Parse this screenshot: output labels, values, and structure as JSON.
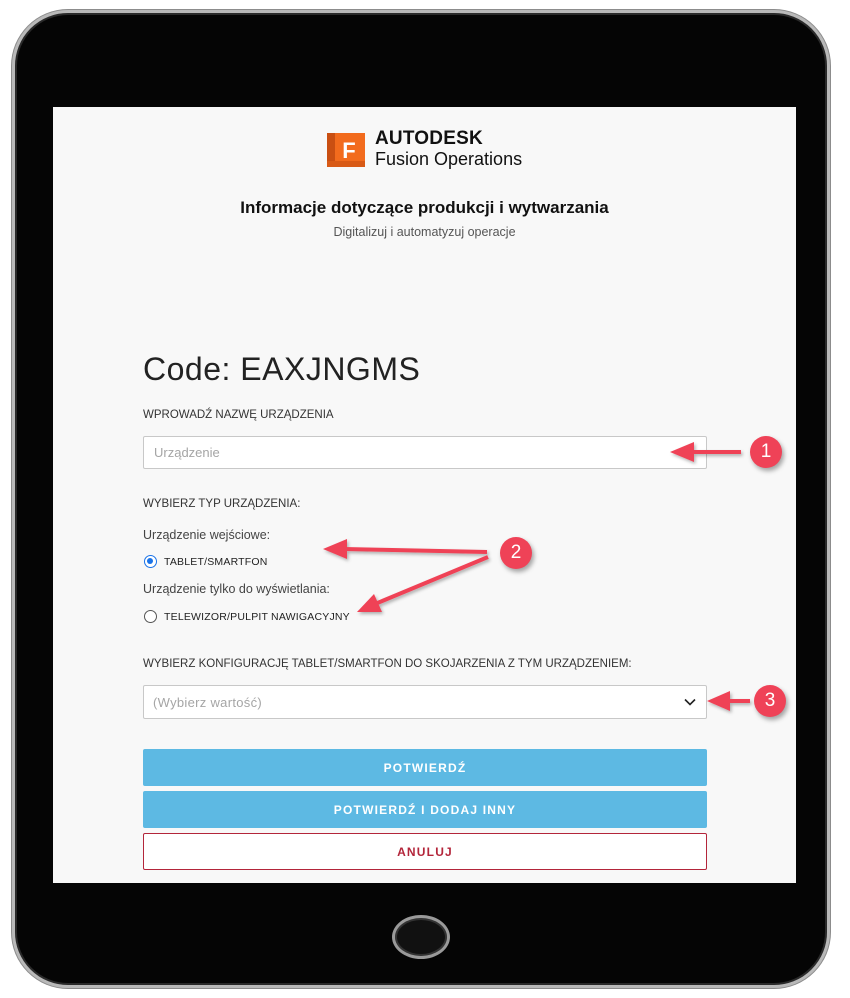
{
  "header": {
    "brand": "AUTODESK",
    "product": "Fusion Operations",
    "logo_letter": "F",
    "headline": "Informacje dotyczące produkcji i wytwarzania",
    "subline": "Digitalizuj i automatyzuj operacje"
  },
  "form": {
    "code_title": "Code: EAXJNGMS",
    "device_name_label": "WPROWADŹ NAZWĘ URZĄDZENIA",
    "device_name_placeholder": "Urządzenie",
    "device_name_value": "",
    "device_type_label": "WYBIERZ TYP URZĄDZENIA:",
    "input_device_label": "Urządzenie wejściowe:",
    "option_tablet": "TABLET/SMARTFON",
    "option_tablet_checked": true,
    "display_device_label": "Urządzenie tylko do wyświetlania:",
    "option_tv": "TELEWIZOR/PULPIT NAWIGACYJNY",
    "option_tv_checked": false,
    "config_label": "WYBIERZ KONFIGURACJĘ TABLET/SMARTFON DO SKOJARZENIA Z TYM URZĄDZENIEM:",
    "config_placeholder": "(Wybierz wartość)"
  },
  "buttons": {
    "confirm": "POTWIERDŹ",
    "confirm_add": "POTWIERDŹ I DODAJ INNY",
    "cancel": "ANULUJ"
  },
  "annotations": {
    "badge_1": "1",
    "badge_2": "2",
    "badge_3": "3",
    "color": "#ef4257"
  },
  "colors": {
    "primary_button": "#5db9e3",
    "cancel_accent": "#b3253a",
    "logo_orange": "#f26b1d",
    "radio_selected": "#1a73e8"
  }
}
